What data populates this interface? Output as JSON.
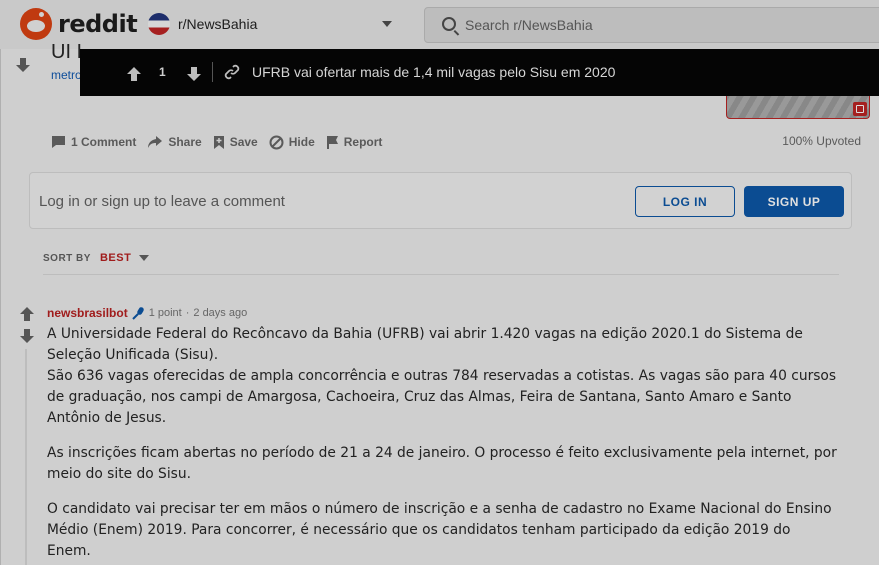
{
  "header": {
    "wordmark": "reddit",
    "subreddit": "r/NewsBahia",
    "search_placeholder": "Search r/NewsBahia"
  },
  "post": {
    "title_fragment": "UI I",
    "link_fragment": "metro"
  },
  "sticky": {
    "score": "1",
    "title": "UFRB vai ofertar mais de 1,4 mil vagas pelo Sisu em 2020"
  },
  "actions": {
    "comments": "1 Comment",
    "share": "Share",
    "save": "Save",
    "hide": "Hide",
    "report": "Report",
    "upvoted": "100% Upvoted"
  },
  "login": {
    "prompt": "Log in or sign up to leave a comment",
    "login_label": "LOG IN",
    "signup_label": "SIGN UP"
  },
  "sort": {
    "label": "SORT BY",
    "value": "BEST"
  },
  "comment": {
    "author": "newsbrasilbot",
    "points": "1 point",
    "separator": "·",
    "age": "2 days ago",
    "paragraphs": [
      "A Universidade Federal do Recôncavo da Bahia (UFRB) vai abrir 1.420 vagas na edição 2020.1 do Sistema de Seleção Unificada (Sisu).",
      "São 636 vagas oferecidas de ampla concorrência e outras 784 reservadas a cotistas. As vagas são para 40 cursos de graduação, nos campi de Amargosa, Cachoeira, Cruz das Almas, Feira de Santana, Santo Amaro e Santo Antônio de Jesus.",
      "As inscrições ficam abertas no período de 21 a 24 de janeiro. O processo é feito exclusivamente pela internet, por meio do site do Sisu.",
      "O candidato vai precisar ter em mãos o número de inscrição e a senha de cadastro no Exame Nacional do Ensino Médio (Enem) 2019. Para concorrer, é necessário que os candidatos tenham participado da edição 2019 do Enem."
    ]
  },
  "colors": {
    "brand": "#c03a10",
    "link_blue": "#0b4c92",
    "author_red": "#a01c1c"
  }
}
